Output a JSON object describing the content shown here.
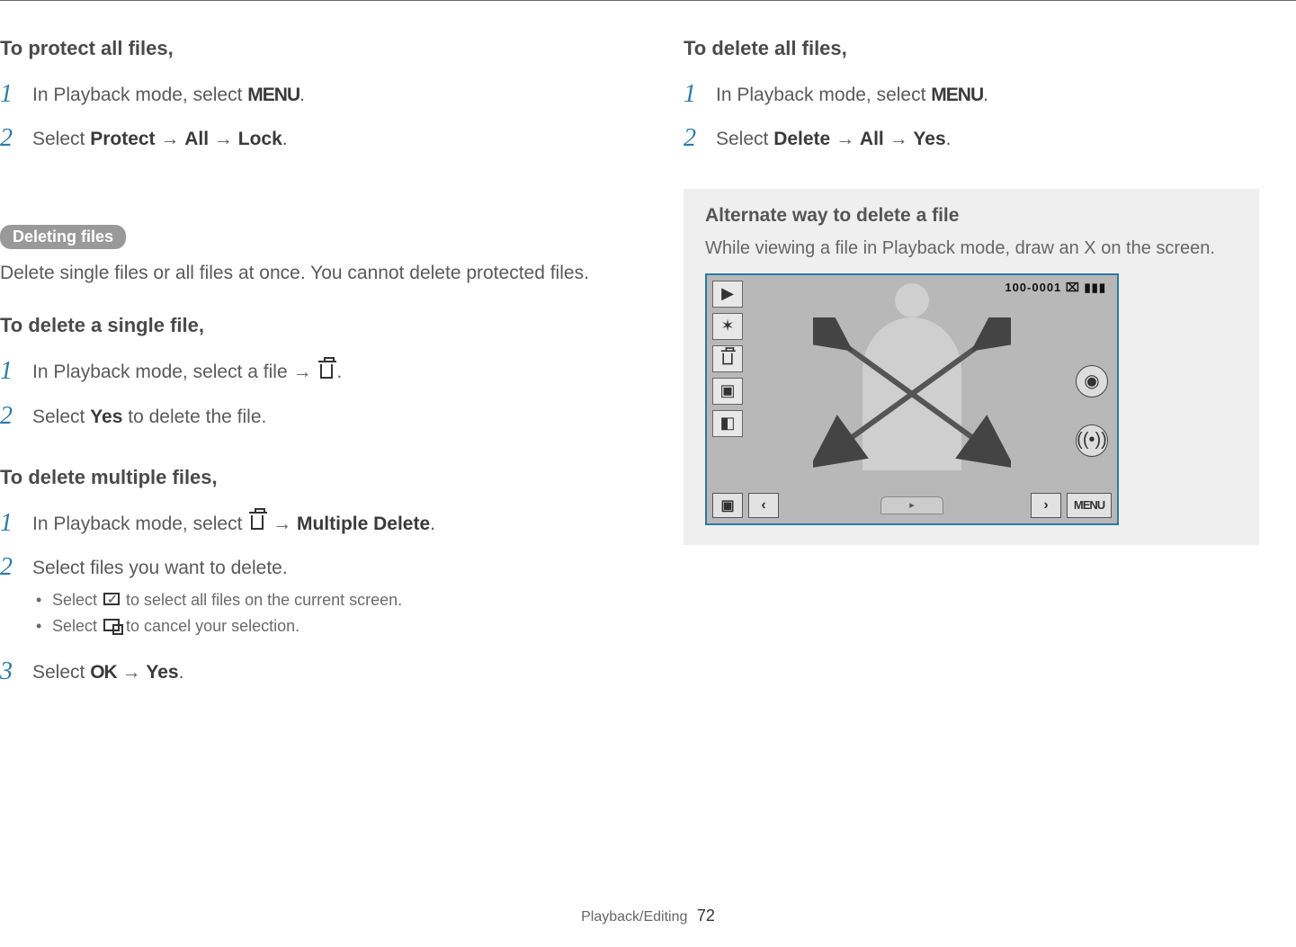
{
  "left": {
    "protect_all_heading": "To protect all files,",
    "protect_all_steps": {
      "s1": "In Playback mode, select ",
      "s1_menu": "MENU",
      "s1_end": ".",
      "s2_a": "Select ",
      "s2_b": "Protect",
      "s2_arrow1": " → ",
      "s2_c": "All",
      "s2_arrow2": " → ",
      "s2_d": "Lock",
      "s2_end": "."
    },
    "deleting_pill": "Deleting files",
    "deleting_desc": "Delete single files or all files at once. You cannot delete protected files.",
    "delete_single_heading": "To delete a single file,",
    "delete_single_steps": {
      "s1_a": "In Playback mode, select a file → ",
      "s1_end": ".",
      "s2_a": "Select ",
      "s2_b": "Yes",
      "s2_c": " to delete the file."
    },
    "delete_multiple_heading": "To delete multiple files,",
    "delete_multiple_steps": {
      "s1_a": "In Playback mode, select ",
      "s1_b": " → ",
      "s1_c": "Multiple Delete",
      "s1_end": ".",
      "s2": "Select files you want to delete.",
      "s2_sub1_a": "Select ",
      "s2_sub1_b": " to select all files on the current screen.",
      "s2_sub2_a": "Select ",
      "s2_sub2_b": " to cancel your selection.",
      "s3_a": "Select ",
      "s3_ok": "OK",
      "s3_b": " → ",
      "s3_c": "Yes",
      "s3_end": "."
    }
  },
  "right": {
    "delete_all_heading": "To delete all files,",
    "delete_all_steps": {
      "s1": "In Playback mode, select ",
      "s1_menu": "MENU",
      "s1_end": ".",
      "s2_a": "Select ",
      "s2_b": "Delete",
      "s2_arrow1": " → ",
      "s2_c": "All",
      "s2_arrow2": " → ",
      "s2_d": "Yes",
      "s2_end": "."
    },
    "alt_title": "Alternate way to delete a file",
    "alt_text": "While viewing a file in Playback mode, draw an X on the screen.",
    "screenshot": {
      "counter": "100-0001",
      "menu": "MENU"
    }
  },
  "footer": {
    "section": "Playback/Editing",
    "page": "72"
  }
}
